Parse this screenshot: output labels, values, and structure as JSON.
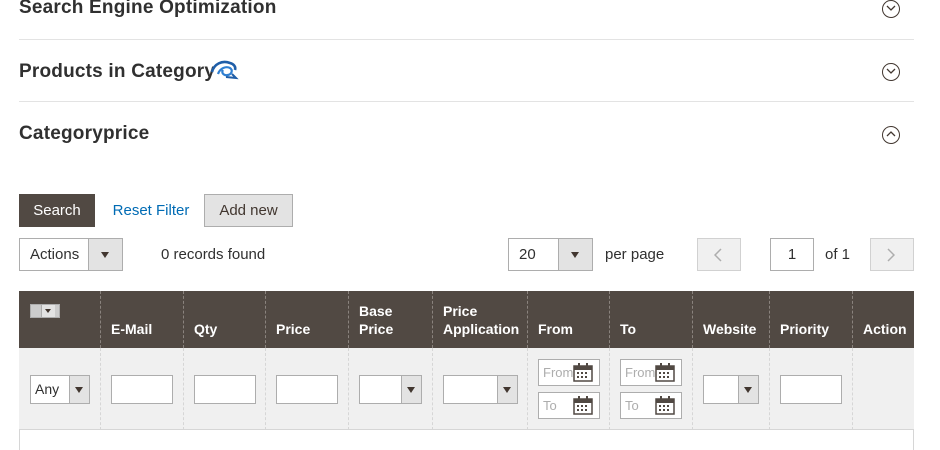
{
  "sections": [
    {
      "title": "Search Engine Optimization",
      "state": "collapsed"
    },
    {
      "title": "Products in Category",
      "state": "collapsed"
    },
    {
      "title": "Categoryprice",
      "state": "expanded"
    }
  ],
  "toolbar": {
    "search_label": "Search",
    "reset_label": "Reset Filter",
    "add_label": "Add new",
    "actions_value": "Actions",
    "records_found": "0 records found",
    "per_page_value": "20",
    "per_page_label": "per page",
    "current_page": "1",
    "total_pages_label": "of 1"
  },
  "grid": {
    "columns": [
      "E-Mail",
      "Qty",
      "Price",
      "Base Price",
      "Price Application",
      "From",
      "To",
      "Website",
      "Priority",
      "Action"
    ],
    "filters": {
      "any_value": "Any",
      "from_placeholder": "From",
      "to_placeholder": "To"
    }
  },
  "colors": {
    "header_bg": "#514943",
    "link": "#006bb4",
    "filter_bg": "#f0f0f0"
  }
}
